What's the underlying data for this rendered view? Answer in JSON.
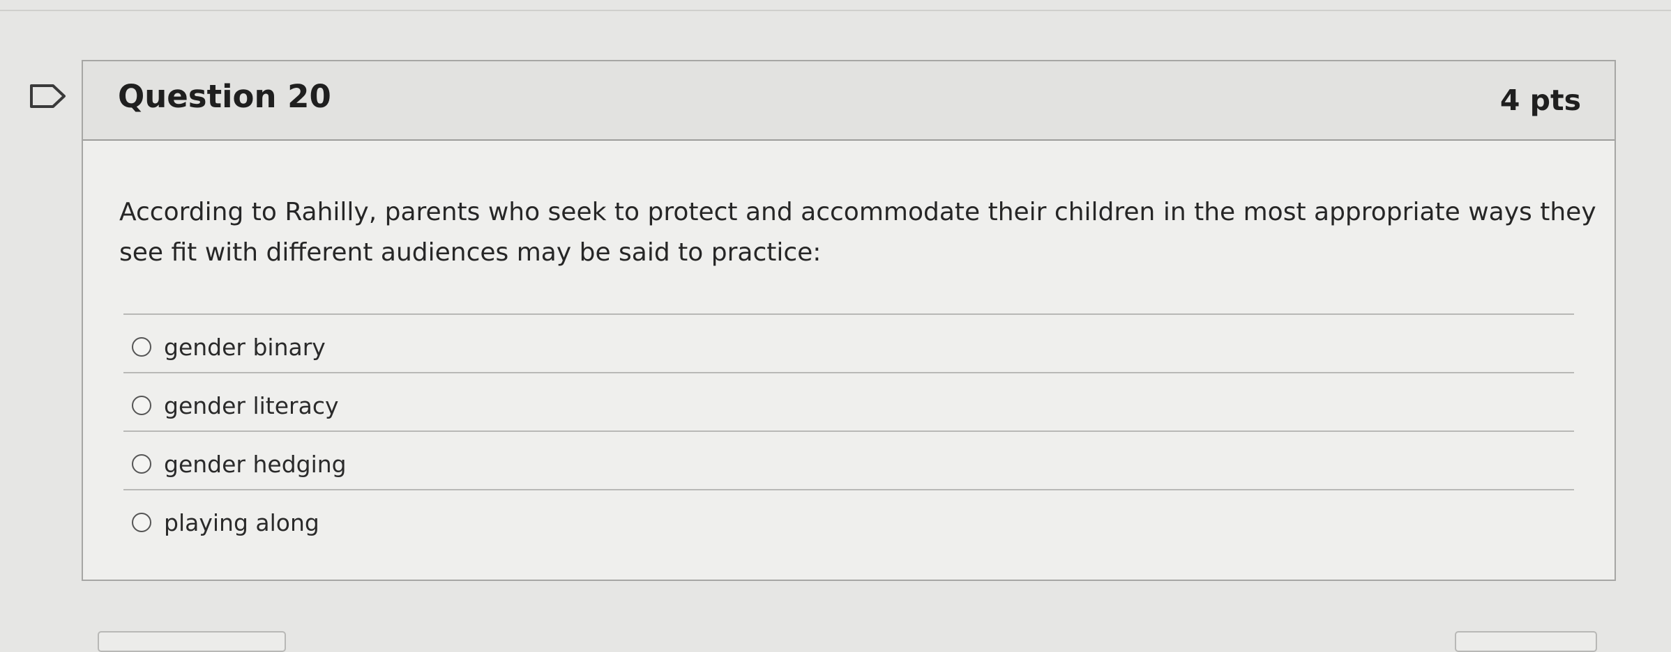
{
  "question": {
    "title": "Question 20",
    "points": "4 pts",
    "text": "According to Rahilly, parents who seek to protect and accommodate their children in the most appropriate ways they see fit with different audiences may be said to practice:",
    "flag_icon": "flag-question-icon",
    "answers": [
      {
        "label": "gender binary",
        "selected": false
      },
      {
        "label": "gender literacy",
        "selected": false
      },
      {
        "label": "gender hedging",
        "selected": false
      },
      {
        "label": "playing along",
        "selected": false
      }
    ]
  },
  "colors": {
    "page_background": "#e6e6e4",
    "header_background": "#e2e2e0",
    "card_background": "#efefed",
    "text": "#222222"
  }
}
